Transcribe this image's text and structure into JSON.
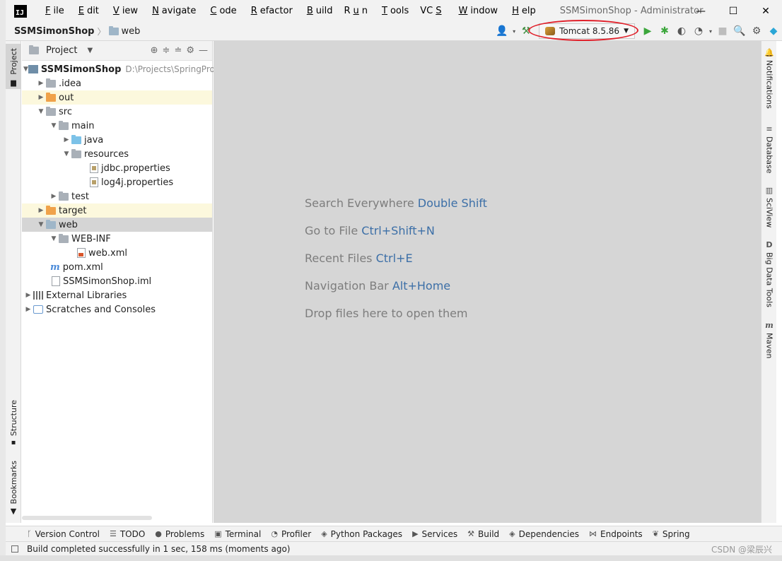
{
  "window": {
    "title": "SSMSimonShop - Administrator",
    "minimize": "—",
    "maximize": "☐",
    "close": "✕"
  },
  "menu": {
    "items": [
      {
        "pre": "",
        "key": "F",
        "post": "ile"
      },
      {
        "pre": "",
        "key": "E",
        "post": "dit"
      },
      {
        "pre": "",
        "key": "V",
        "post": "iew"
      },
      {
        "pre": "",
        "key": "N",
        "post": "avigate"
      },
      {
        "pre": "",
        "key": "C",
        "post": "ode"
      },
      {
        "pre": "",
        "key": "R",
        "post": "efactor"
      },
      {
        "pre": "",
        "key": "B",
        "post": "uild"
      },
      {
        "pre": "R",
        "key": "u",
        "post": "n"
      },
      {
        "pre": "",
        "key": "T",
        "post": "ools"
      },
      {
        "pre": "VC",
        "key": "S",
        "post": ""
      },
      {
        "pre": "",
        "key": "W",
        "post": "indow"
      },
      {
        "pre": "",
        "key": "H",
        "post": "elp"
      }
    ]
  },
  "navbar": {
    "project": "SSMSimonShop",
    "separator": "〉",
    "folder": "web",
    "run_config": "Tomcat 8.5.86"
  },
  "left_stripe": {
    "project": "Project",
    "structure": "Structure",
    "bookmarks": "Bookmarks"
  },
  "project_panel": {
    "title": "Project",
    "tree": [
      {
        "label": "SSMSimonShop",
        "hint": "D:\\Projects\\SpringProj"
      },
      {
        "label": ".idea"
      },
      {
        "label": "out"
      },
      {
        "label": "src"
      },
      {
        "label": "main"
      },
      {
        "label": "java"
      },
      {
        "label": "resources"
      },
      {
        "label": "jdbc.properties"
      },
      {
        "label": "log4j.properties"
      },
      {
        "label": "test"
      },
      {
        "label": "target"
      },
      {
        "label": "web"
      },
      {
        "label": "WEB-INF"
      },
      {
        "label": "web.xml"
      },
      {
        "label": "pom.xml"
      },
      {
        "label": "SSMSimonShop.iml"
      },
      {
        "label": "External Libraries"
      },
      {
        "label": "Scratches and Consoles"
      }
    ]
  },
  "editor": {
    "hints": [
      {
        "text": "Search Everywhere ",
        "key": "Double Shift"
      },
      {
        "text": "Go to File ",
        "key": "Ctrl+Shift+N"
      },
      {
        "text": "Recent Files ",
        "key": "Ctrl+E"
      },
      {
        "text": "Navigation Bar ",
        "key": "Alt+Home"
      },
      {
        "text": "Drop files here to open them",
        "key": ""
      }
    ]
  },
  "right_stripe": {
    "notifications": "Notifications",
    "database": "Database",
    "sciview": "SciView",
    "bigdata": "Big Data Tools",
    "maven": "Maven"
  },
  "bottom_tabs": [
    {
      "label": "Version Control"
    },
    {
      "label": "TODO"
    },
    {
      "label": "Problems"
    },
    {
      "label": "Terminal"
    },
    {
      "label": "Profiler"
    },
    {
      "label": "Python Packages"
    },
    {
      "label": "Services"
    },
    {
      "label": "Build"
    },
    {
      "label": "Dependencies"
    },
    {
      "label": "Endpoints"
    },
    {
      "label": "Spring"
    }
  ],
  "status": {
    "message": "Build completed successfully in 1 sec, 158 ms (moments ago)",
    "watermark": "CSDN @梁辰兴"
  }
}
